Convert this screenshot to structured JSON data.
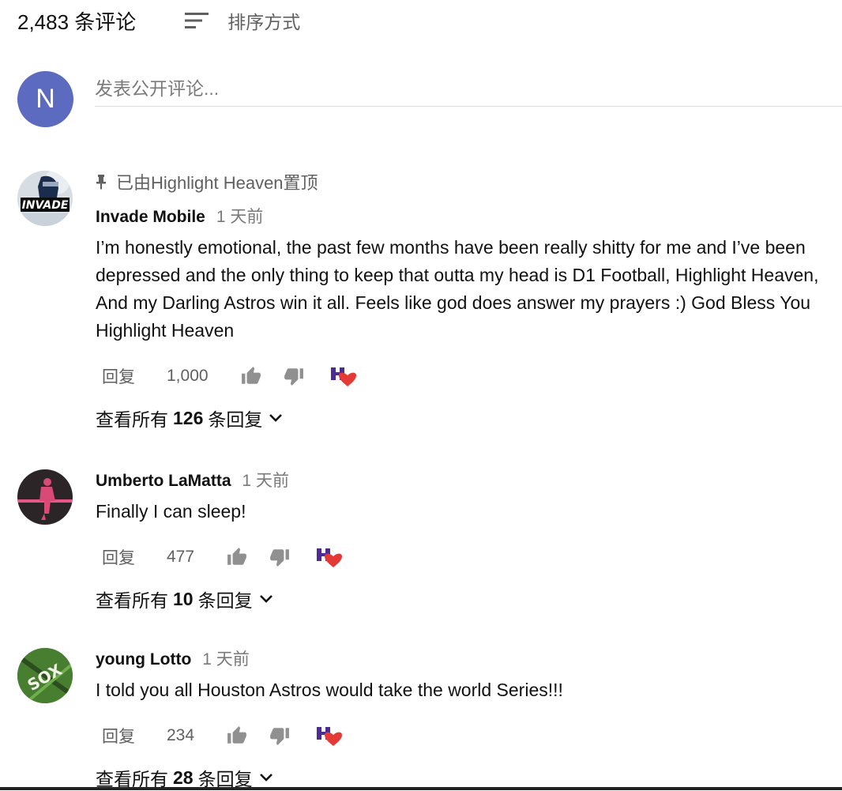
{
  "header": {
    "count": "2,483 条评论",
    "sort_label": "排序方式"
  },
  "compose": {
    "avatar_letter": "N",
    "placeholder": "发表公开评论..."
  },
  "comments": [
    {
      "pinned_text": "已由Highlight Heaven置顶",
      "author": "Invade Mobile",
      "time": "1 天前",
      "text": "I’m honestly emotional, the past few months have been really shitty for me and I’ve been depressed and the only thing to keep that outta my head is D1 Football, Highlight Heaven, And my Darling Astros win it all. Feels like god does answer my prayers :) God Bless You Highlight Heaven",
      "reply_label": "回复",
      "likes": "1,000",
      "view_pre": "查看所有",
      "view_count": "126",
      "view_post": "条回复",
      "avatar_text": "INVADE"
    },
    {
      "author": "Umberto LaMatta",
      "time": "1 天前",
      "text": "Finally I can sleep!",
      "reply_label": "回复",
      "likes": "477",
      "view_pre": "查看所有",
      "view_count": "10",
      "view_post": "条回复"
    },
    {
      "author": "young Lotto",
      "time": "1 天前",
      "text": "I told you all Houston Astros would take the world Series!!!",
      "reply_label": "回复",
      "likes": "234",
      "view_pre": "查看所有",
      "view_count": "28",
      "view_post": "条回复",
      "avatar_text": "SOX"
    }
  ],
  "colors": {
    "heart": "#e53935",
    "compose_avatar": "#5c6bc0",
    "secondary_text": "#606060"
  },
  "icons": {
    "sort": "sort-icon",
    "pin": "pin-icon",
    "like": "thumb-up-icon",
    "dislike": "thumb-down-icon",
    "creator_heart": "creator-heart-icon",
    "expand": "chevron-down-icon"
  }
}
